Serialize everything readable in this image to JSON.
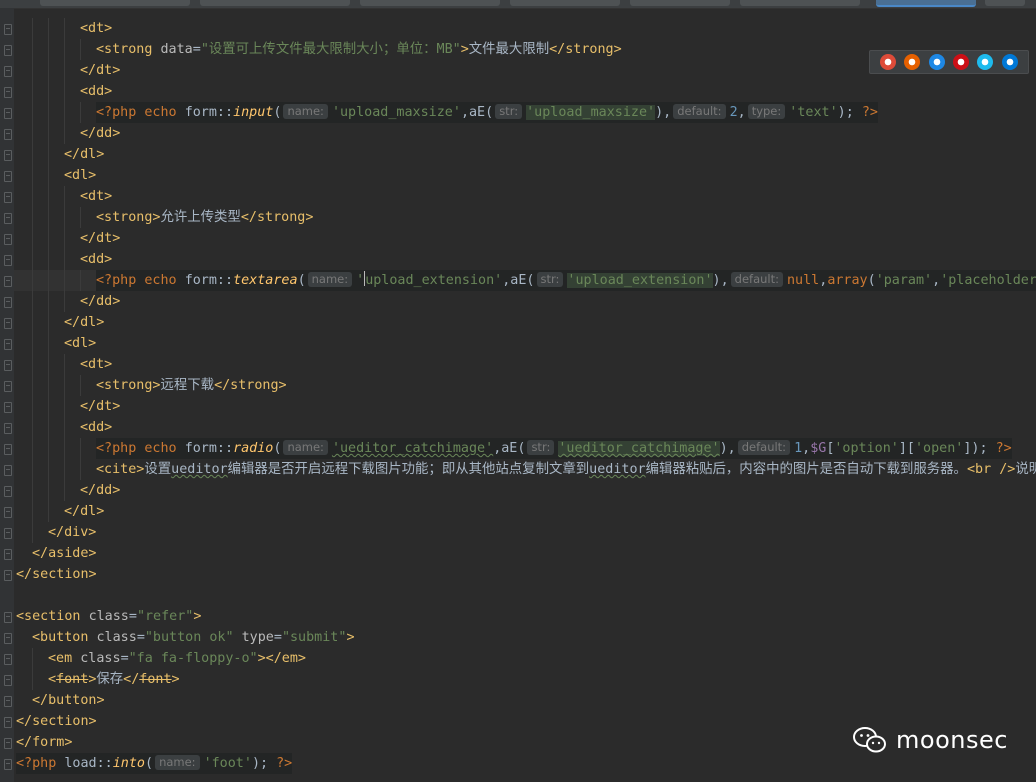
{
  "editor": {
    "lines": [
      {
        "segments": [
          {
            "t": "tag",
            "v": "<dt>"
          }
        ]
      },
      {
        "segments": [
          {
            "t": "tag",
            "v": "<strong "
          },
          {
            "t": "attr",
            "v": "data"
          },
          {
            "t": "txt",
            "v": "="
          },
          {
            "t": "str",
            "v": "\"设置可上传文件最大限制大小；单位：MB\""
          },
          {
            "t": "tag",
            "v": ">"
          },
          {
            "t": "txt",
            "v": "文件最大限制"
          },
          {
            "t": "tag",
            "v": "</strong>"
          }
        ]
      },
      {
        "segments": [
          {
            "t": "tag",
            "v": "</dt>"
          }
        ]
      },
      {
        "segments": [
          {
            "t": "tag",
            "v": "<dd>"
          }
        ]
      },
      {
        "segments": [
          {
            "t": "php",
            "v": "<?php "
          },
          {
            "t": "kw",
            "v": "echo "
          },
          {
            "t": "cls",
            "v": "form::"
          },
          {
            "t": "fn",
            "v": "input"
          },
          {
            "t": "txt",
            "v": "("
          },
          {
            "t": "hint",
            "v": "name:"
          },
          {
            "t": "str",
            "v": "'upload_maxsize'"
          },
          {
            "t": "txt",
            "v": ",aE("
          },
          {
            "t": "hint",
            "v": "str:"
          },
          {
            "t": "hl",
            "v": "'upload_maxsize'"
          },
          {
            "t": "txt",
            "v": "),"
          },
          {
            "t": "hint",
            "v": "default:"
          },
          {
            "t": "num",
            "v": "2"
          },
          {
            "t": "txt",
            "v": ","
          },
          {
            "t": "hint",
            "v": "type:"
          },
          {
            "t": "str",
            "v": "'text'"
          },
          {
            "t": "txt",
            "v": "); "
          },
          {
            "t": "php",
            "v": "?>"
          }
        ]
      },
      {
        "segments": [
          {
            "t": "tag",
            "v": "</dd>"
          }
        ]
      },
      {
        "segments": [
          {
            "t": "tag",
            "v": "</dl>"
          }
        ]
      },
      {
        "segments": [
          {
            "t": "tag",
            "v": "<dl>"
          }
        ]
      },
      {
        "segments": [
          {
            "t": "tag",
            "v": "<dt>"
          }
        ]
      },
      {
        "segments": [
          {
            "t": "tag",
            "v": "<strong>"
          },
          {
            "t": "txt",
            "v": "允许上传类型"
          },
          {
            "t": "tag",
            "v": "</strong>"
          }
        ]
      },
      {
        "segments": [
          {
            "t": "tag",
            "v": "</dt>"
          }
        ]
      },
      {
        "segments": [
          {
            "t": "tag",
            "v": "<dd>"
          }
        ]
      },
      {
        "segments": [
          {
            "t": "php",
            "v": "<?php "
          },
          {
            "t": "kw",
            "v": "echo "
          },
          {
            "t": "cls",
            "v": "form::"
          },
          {
            "t": "fn",
            "v": "textarea"
          },
          {
            "t": "txt",
            "v": "("
          },
          {
            "t": "hint",
            "v": "name:"
          },
          {
            "t": "str",
            "v": "'upload_extension'"
          },
          {
            "t": "txt",
            "v": ",aE("
          },
          {
            "t": "hint",
            "v": "str:"
          },
          {
            "t": "hl",
            "v": "'upload_extension'"
          },
          {
            "t": "txt",
            "v": "),"
          },
          {
            "t": "hint",
            "v": "default:"
          },
          {
            "t": "kw",
            "v": "null"
          },
          {
            "t": "txt",
            "v": ","
          },
          {
            "t": "kw",
            "v": "array"
          },
          {
            "t": "txt",
            "v": "("
          },
          {
            "t": "str",
            "v": "'param'"
          },
          {
            "t": "txt",
            "v": ","
          },
          {
            "t": "str",
            "v": "'placeholder'"
          },
          {
            "t": "txt",
            "v": "=>"
          }
        ]
      },
      {
        "segments": [
          {
            "t": "tag",
            "v": "</dd>"
          }
        ]
      },
      {
        "segments": [
          {
            "t": "tag",
            "v": "</dl>"
          }
        ]
      },
      {
        "segments": [
          {
            "t": "tag",
            "v": "<dl>"
          }
        ]
      },
      {
        "segments": [
          {
            "t": "tag",
            "v": "<dt>"
          }
        ]
      },
      {
        "segments": [
          {
            "t": "tag",
            "v": "<strong>"
          },
          {
            "t": "txt",
            "v": "远程下载"
          },
          {
            "t": "tag",
            "v": "</strong>"
          }
        ]
      },
      {
        "segments": [
          {
            "t": "tag",
            "v": "</dt>"
          }
        ]
      },
      {
        "segments": [
          {
            "t": "tag",
            "v": "<dd>"
          }
        ]
      },
      {
        "segments": [
          {
            "t": "php",
            "v": "<?php "
          },
          {
            "t": "kw",
            "v": "echo "
          },
          {
            "t": "cls",
            "v": "form::"
          },
          {
            "t": "fn",
            "v": "radio"
          },
          {
            "t": "txt",
            "v": "("
          },
          {
            "t": "hint",
            "v": "name:"
          },
          {
            "t": "str",
            "v": "'ueditor_catchimage'"
          },
          {
            "t": "txt",
            "v": ",aE("
          },
          {
            "t": "hint",
            "v": "str:"
          },
          {
            "t": "hl",
            "v": "'ueditor_catchimage'"
          },
          {
            "t": "txt",
            "v": "),"
          },
          {
            "t": "hint",
            "v": "default:"
          },
          {
            "t": "num",
            "v": "1"
          },
          {
            "t": "txt",
            "v": ","
          },
          {
            "t": "var",
            "v": "$G"
          },
          {
            "t": "txt",
            "v": "["
          },
          {
            "t": "str",
            "v": "'option'"
          },
          {
            "t": "txt",
            "v": "]["
          },
          {
            "t": "str",
            "v": "'open'"
          },
          {
            "t": "txt",
            "v": "]); "
          },
          {
            "t": "php",
            "v": "?>"
          }
        ]
      },
      {
        "segments": [
          {
            "t": "tag",
            "v": "<cite>"
          },
          {
            "t": "txt",
            "v": "设置ueditor编辑器是否开启远程下载图片功能；即从其他站点复制文章到ueditor编辑器粘贴后，内容中的图片是否自动下载到服务器。"
          },
          {
            "t": "tag",
            "v": "<br />"
          },
          {
            "t": "txt",
            "v": "说明：在"
          }
        ]
      },
      {
        "segments": [
          {
            "t": "tag",
            "v": "</dd>"
          }
        ]
      },
      {
        "segments": [
          {
            "t": "tag",
            "v": "</dl>"
          }
        ]
      },
      {
        "segments": [
          {
            "t": "tag",
            "v": "</div>"
          }
        ]
      },
      {
        "segments": [
          {
            "t": "tag",
            "v": "</aside>"
          }
        ]
      },
      {
        "segments": [
          {
            "t": "tag",
            "v": "</section>"
          }
        ]
      },
      {
        "segments": []
      },
      {
        "segments": [
          {
            "t": "tag",
            "v": "<section "
          },
          {
            "t": "attr",
            "v": "class"
          },
          {
            "t": "txt",
            "v": "="
          },
          {
            "t": "str",
            "v": "\"refer\""
          },
          {
            "t": "tag",
            "v": ">"
          }
        ]
      },
      {
        "segments": [
          {
            "t": "tag",
            "v": "<button "
          },
          {
            "t": "attr",
            "v": "class"
          },
          {
            "t": "txt",
            "v": "="
          },
          {
            "t": "str",
            "v": "\"button ok\""
          },
          {
            "t": "txt",
            "v": " "
          },
          {
            "t": "attr",
            "v": "type"
          },
          {
            "t": "txt",
            "v": "="
          },
          {
            "t": "str",
            "v": "\"submit\""
          },
          {
            "t": "tag",
            "v": ">"
          }
        ]
      },
      {
        "segments": [
          {
            "t": "tag",
            "v": "<em "
          },
          {
            "t": "attr",
            "v": "class"
          },
          {
            "t": "txt",
            "v": "="
          },
          {
            "t": "str",
            "v": "\"fa fa-floppy-o\""
          },
          {
            "t": "tag",
            "v": "></em>"
          }
        ]
      },
      {
        "segments": [
          {
            "t": "tag",
            "v": "<"
          },
          {
            "t": "strike",
            "v": "font"
          },
          {
            "t": "tag",
            "v": ">"
          },
          {
            "t": "txt",
            "v": "保存"
          },
          {
            "t": "tag",
            "v": "</"
          },
          {
            "t": "strike",
            "v": "font"
          },
          {
            "t": "tag",
            "v": ">"
          }
        ]
      },
      {
        "segments": [
          {
            "t": "tag",
            "v": "</button>"
          }
        ]
      },
      {
        "segments": [
          {
            "t": "tag",
            "v": "</section>"
          }
        ]
      },
      {
        "segments": [
          {
            "t": "tag",
            "v": "</form>"
          }
        ]
      },
      {
        "segments": [
          {
            "t": "php",
            "v": "<?php "
          },
          {
            "t": "cls",
            "v": "load::"
          },
          {
            "t": "fn",
            "v": "into"
          },
          {
            "t": "txt",
            "v": "("
          },
          {
            "t": "hint",
            "v": "name:"
          },
          {
            "t": "str",
            "v": "'foot'"
          },
          {
            "t": "txt",
            "v": "); "
          },
          {
            "t": "php",
            "v": "?>"
          }
        ]
      }
    ]
  },
  "browser_bar": {
    "icons": [
      {
        "name": "chrome-icon",
        "color": "#dd4b39"
      },
      {
        "name": "firefox-icon",
        "color": "#e66000"
      },
      {
        "name": "safari-icon",
        "color": "#1e88e5"
      },
      {
        "name": "opera-icon",
        "color": "#cc0f16"
      },
      {
        "name": "ie-icon",
        "color": "#1ebbee"
      },
      {
        "name": "edge-icon",
        "color": "#0078d7"
      }
    ]
  },
  "watermark": {
    "label": "moonsec",
    "icon": "wechat-icon"
  }
}
